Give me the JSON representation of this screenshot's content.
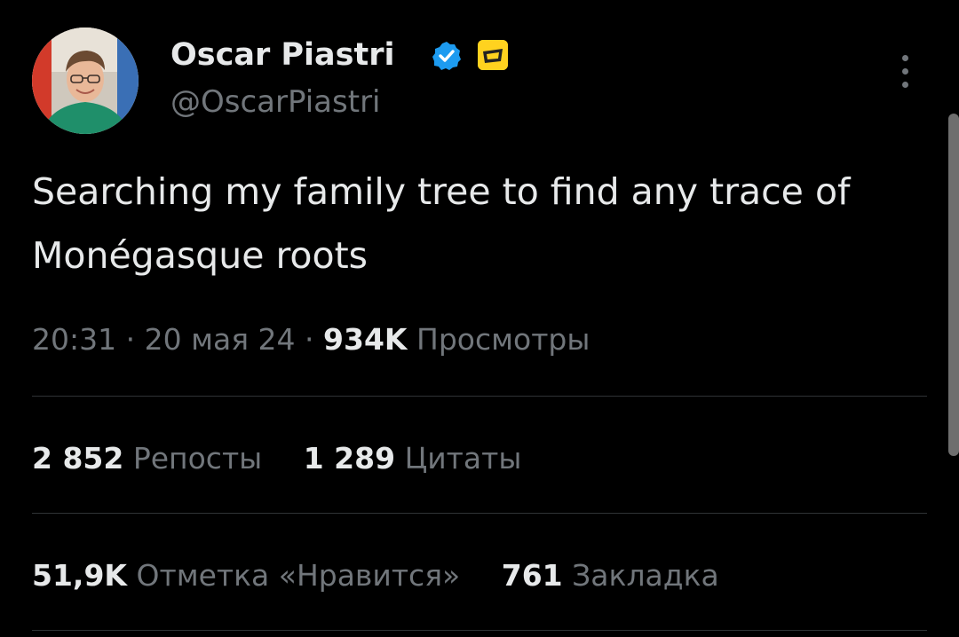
{
  "author": {
    "display_name": "Oscar Piastri",
    "handle": "@OscarPiastri",
    "avatar_icon": "profile-photo",
    "verified_icon": "verified-badge-icon",
    "affiliation_icon": "team-badge-icon"
  },
  "tweet": {
    "text": "Searching my family tree to find any trace of Monégasque roots",
    "time": "20:31",
    "date": "20 мая 24",
    "separator": "·",
    "views_count": "934K",
    "views_label": "Просмотры"
  },
  "stats": {
    "reposts_count": "2 852",
    "reposts_label": "Репосты",
    "quotes_count": "1 289",
    "quotes_label": "Цитаты",
    "likes_count": "51,9K",
    "likes_label": "Отметка «Нравится»",
    "bookmarks_count": "761",
    "bookmarks_label": "Закладка"
  },
  "colors": {
    "background": "#000000",
    "primary_text": "#e7e9ea",
    "secondary_text": "#71767b",
    "verified_blue": "#1d9bf0",
    "divider": "#2f3336"
  }
}
